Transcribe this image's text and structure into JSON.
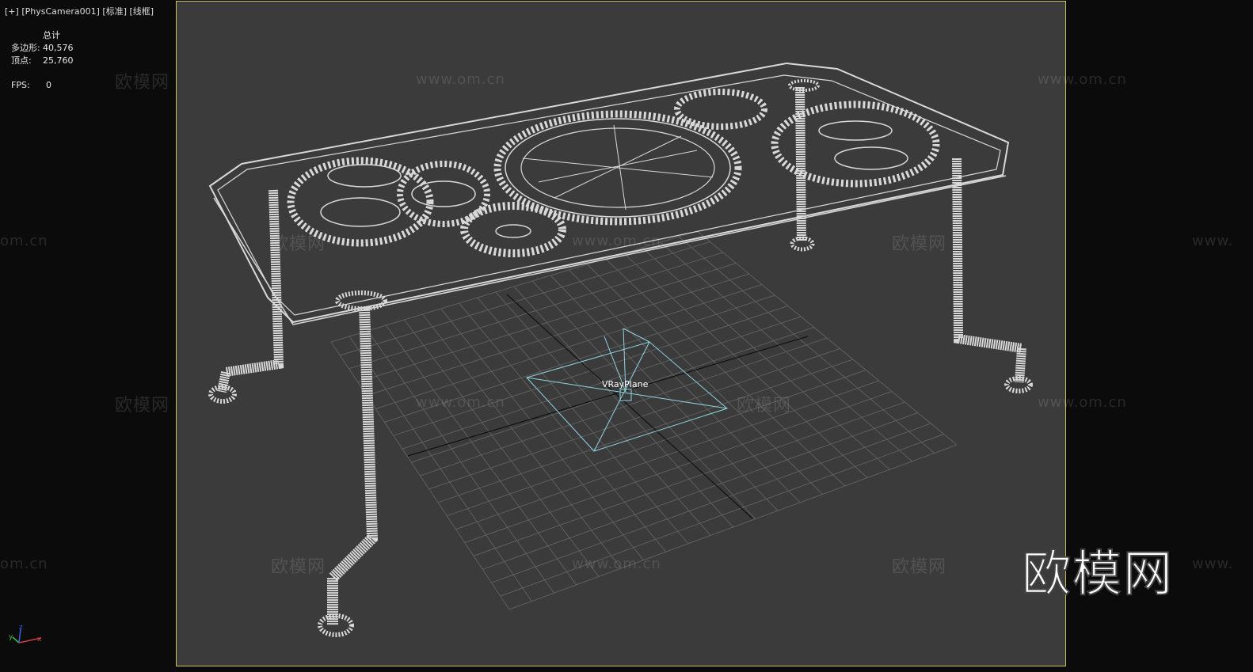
{
  "viewport": {
    "label_plus": "[+]",
    "label_camera": "[PhysCamera001]",
    "label_mode": "[标准]",
    "label_shading": "[线框]"
  },
  "stats": {
    "header": "总计",
    "polygons_label": "多边形:",
    "polygons_value": "40,576",
    "vertices_label": "顶点:",
    "vertices_value": "25,760",
    "fps_label": "FPS:",
    "fps_value": "0"
  },
  "scene": {
    "object_label": "VRayPlane",
    "axis_x": "x",
    "axis_y": "y",
    "axis_z": "z"
  },
  "watermarks": {
    "brand": "欧模网",
    "url": "www.om.cn",
    "url_partial": "om.cn",
    "url_prefix": "www."
  },
  "colors": {
    "viewport_bg": "#3b3b3b",
    "frame_border": "#c9c45a",
    "wire": "#d8d8d8",
    "vray_plane": "#8fd3e0"
  }
}
